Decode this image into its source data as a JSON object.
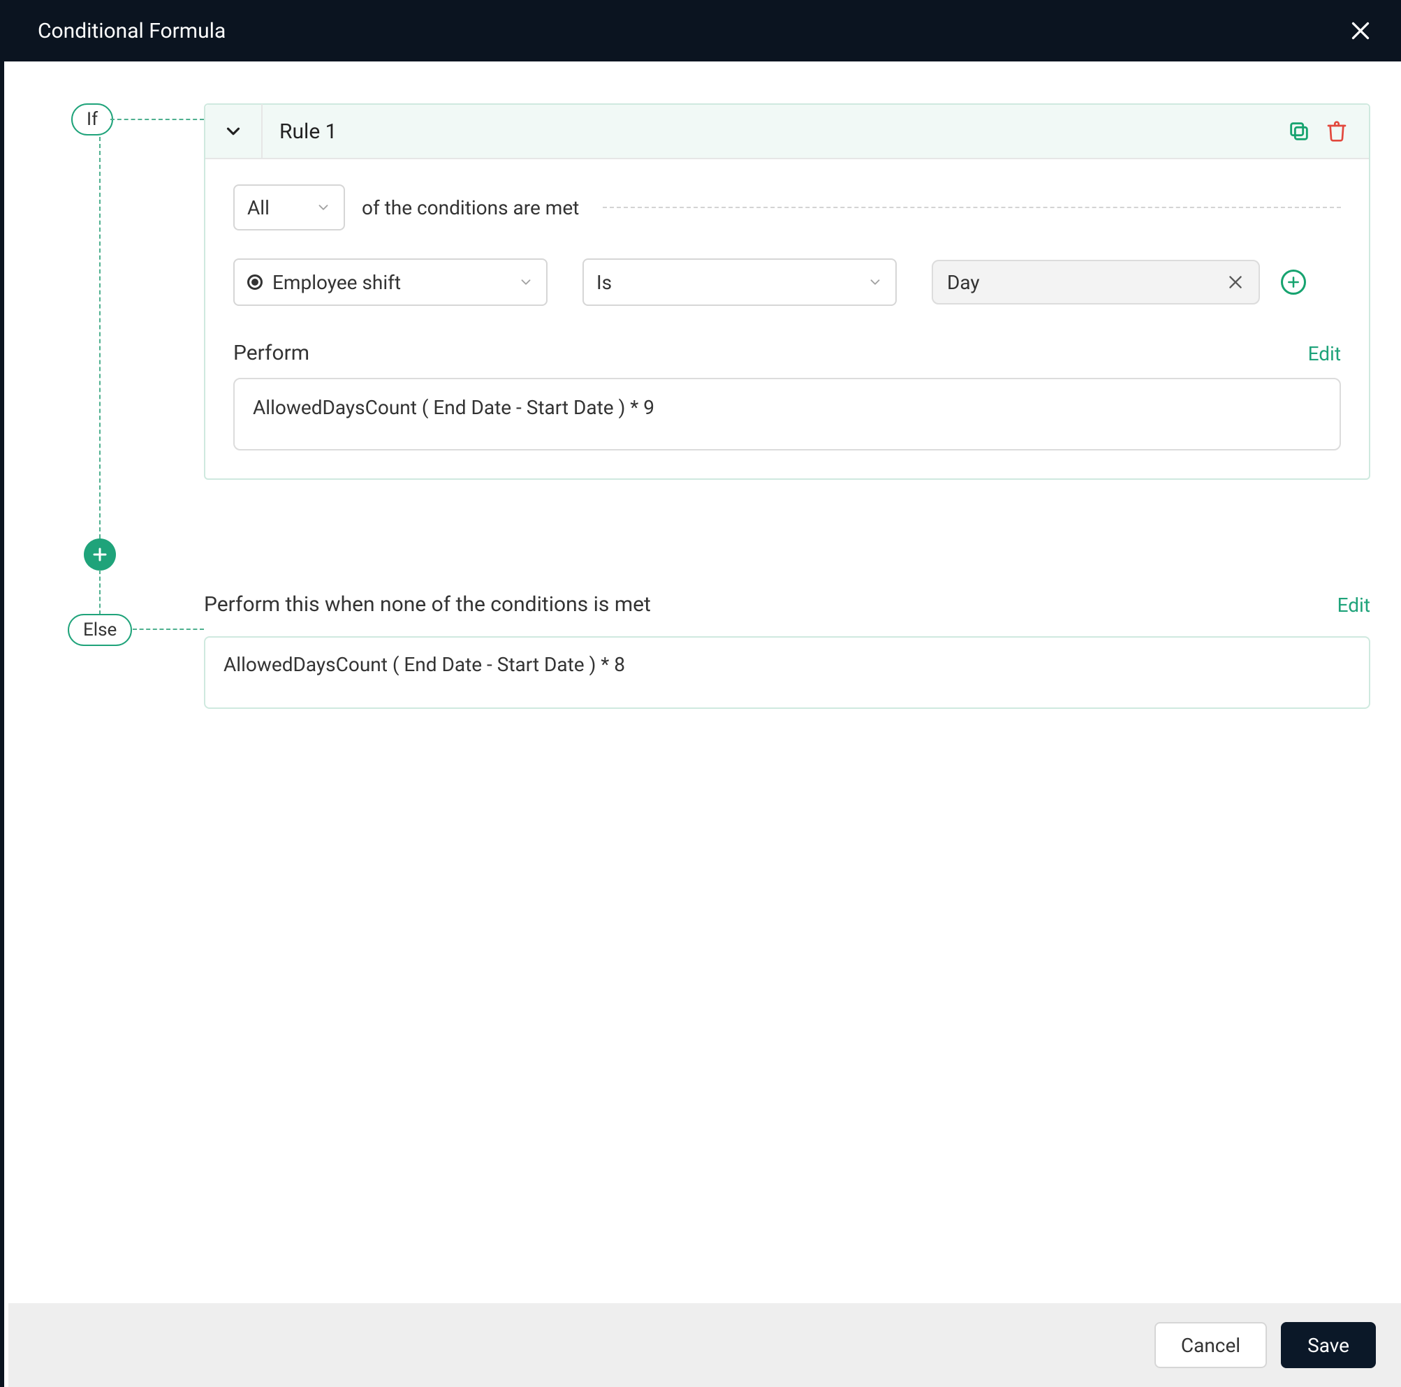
{
  "header": {
    "title": "Conditional Formula"
  },
  "rail": {
    "if_label": "If",
    "else_label": "Else"
  },
  "rule": {
    "title": "Rule 1",
    "match_mode": "All",
    "match_text": "of the conditions are met",
    "condition": {
      "field": "Employee shift",
      "operator": "Is",
      "value": "Day"
    },
    "perform_label": "Perform",
    "edit_label": "Edit",
    "formula": "AllowedDaysCount ( End Date - Start Date ) * 9"
  },
  "else_block": {
    "text": "Perform this when none of the conditions is met",
    "edit_label": "Edit",
    "formula": "AllowedDaysCount ( End Date - Start Date ) * 8"
  },
  "footer": {
    "cancel": "Cancel",
    "save": "Save"
  }
}
